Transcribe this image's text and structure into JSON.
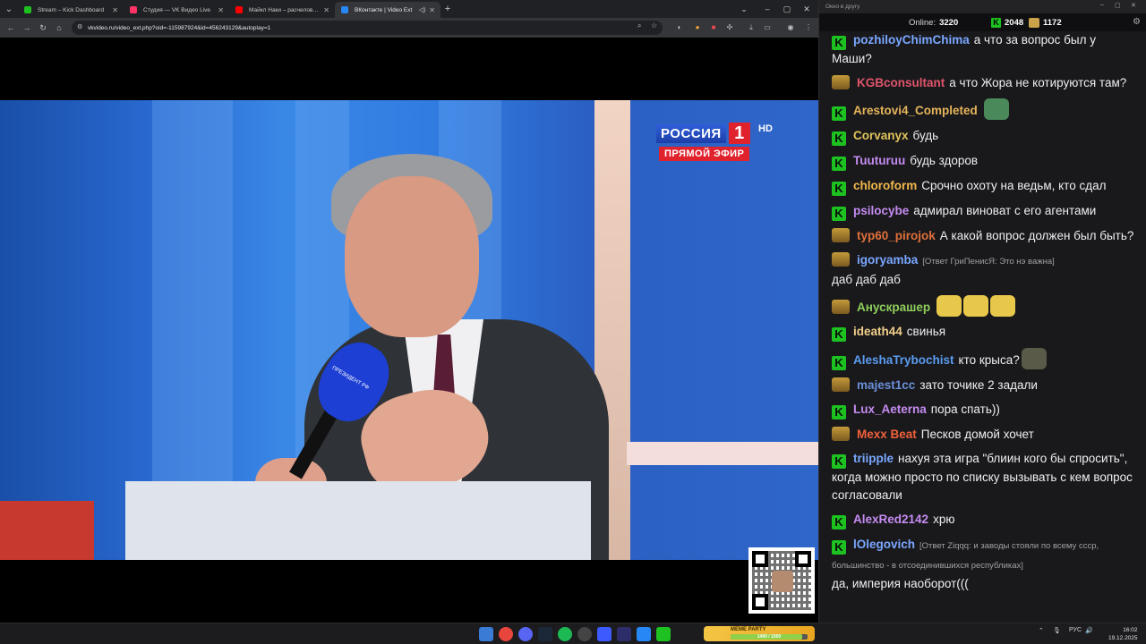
{
  "browser": {
    "tabs": [
      {
        "title": "Stream – Kick Dashboard",
        "favicon_color": "#1dc221",
        "active": false
      },
      {
        "title": "Студия — VK Видео Live",
        "favicon_color": "#ff3366",
        "active": false
      },
      {
        "title": "Майкл Наки – расчеловечиван",
        "favicon_color": "#ff0000",
        "active": false
      },
      {
        "title": "ВКонтакте | Video Ext",
        "favicon_color": "#2787f5",
        "active": true
      }
    ],
    "url": "vkvideo.ru/video_ext.php?oid=-115987924&id=456243129&autoplay=1"
  },
  "video": {
    "channel_name": "РОССИЯ",
    "channel_number": "1",
    "hd_label": "HD",
    "live_label": "ПРЯМОЙ ЭФИР",
    "mic_label": "ПРЕЗИДЕНТ РФ"
  },
  "chat": {
    "window_title": "Окно в другу",
    "online_label": "Online:",
    "online_count": "3220",
    "followers_count": "2048",
    "subs_count": "1172",
    "messages": [
      {
        "badge": "k",
        "user": "pozhiloyChimChima",
        "color": "#7aa7ff",
        "reply": "",
        "text": "а что за вопрос был у Маши?"
      },
      {
        "badge": "crown",
        "user": "KGBconsultant",
        "color": "#e0556b",
        "reply": "",
        "text": "а что Жора не котируются там?"
      },
      {
        "badge": "k",
        "user": "Arestovi4_Completed",
        "color": "#e6b45a",
        "reply": "",
        "text": "",
        "emotes": [
          "#4a8a5a"
        ]
      },
      {
        "badge": "k",
        "user": "Corvanyx",
        "color": "#e0c45a",
        "reply": "",
        "text": "будь"
      },
      {
        "badge": "k",
        "user": "Tuuturuu",
        "color": "#c58cf0",
        "reply": "",
        "text": "будь здоров"
      },
      {
        "badge": "k",
        "user": "chloroform",
        "color": "#f2b84b",
        "reply": "",
        "text": "Срочно охоту на ведьм, кто сдал"
      },
      {
        "badge": "k",
        "user": "psilocybe",
        "color": "#c58cf0",
        "reply": "",
        "text": "адмирал виноват с его агентами"
      },
      {
        "badge": "crown",
        "user": "typ60_pirojok",
        "color": "#e0703a",
        "reply": "",
        "text": "А какой вопрос должен был быть?"
      },
      {
        "badge": "crown",
        "user": "igoryamba",
        "color": "#7aa7ff",
        "reply": "[Ответ ГриПенисЯ: Это нэ важна]",
        "text": "даб даб даб"
      },
      {
        "badge": "crown",
        "user": "Анускрашер",
        "color": "#8fce5a",
        "reply": "",
        "text": "",
        "emotes": [
          "#e8c84a",
          "#e8c84a",
          "#e8c84a"
        ]
      },
      {
        "badge": "k",
        "user": "ideath44",
        "color": "#f2d08a",
        "reply": "",
        "text": "свинья"
      },
      {
        "badge": "k",
        "user": "AleshaTrybochist",
        "color": "#5a9cf0",
        "reply": "",
        "text": "кто крыса?",
        "emotes": [
          "#5a5a48"
        ]
      },
      {
        "badge": "crown",
        "user": "majest1cc",
        "color": "#6a8fd8",
        "reply": "",
        "text": "зато точике 2 задали"
      },
      {
        "badge": "k",
        "user": "Lux_Aeterna",
        "color": "#c58cf0",
        "reply": "",
        "text": "пора спать))"
      },
      {
        "badge": "crown",
        "user": "Mexx Beat",
        "color": "#f0603a",
        "reply": "",
        "text": "Песков домой хочет"
      },
      {
        "badge": "k",
        "user": "triipple",
        "color": "#7aa7ff",
        "reply": "",
        "text": "нахуя эта игра \"блиин кого бы спросить\", когда можно просто по списку вызывать с кем вопрос согласовали"
      },
      {
        "badge": "k",
        "user": "AlexRed2142",
        "color": "#c58cf0",
        "reply": "",
        "text": "хрю"
      },
      {
        "badge": "k",
        "user": "lOlegovich",
        "color": "#7aa7ff",
        "reply": "[Ответ Ziqqq: и заводы стояли по всему ссср, большинство - в отсоединившихся республиках]",
        "text": "да, империя наоборот((("
      }
    ]
  },
  "taskbar": {
    "widget_title": "MEME PARTY",
    "widget_progress": "1400 / 1500",
    "widget_fraction": 0.93,
    "lang": "РУС",
    "time": "16:02",
    "date": "19.12.2025"
  }
}
